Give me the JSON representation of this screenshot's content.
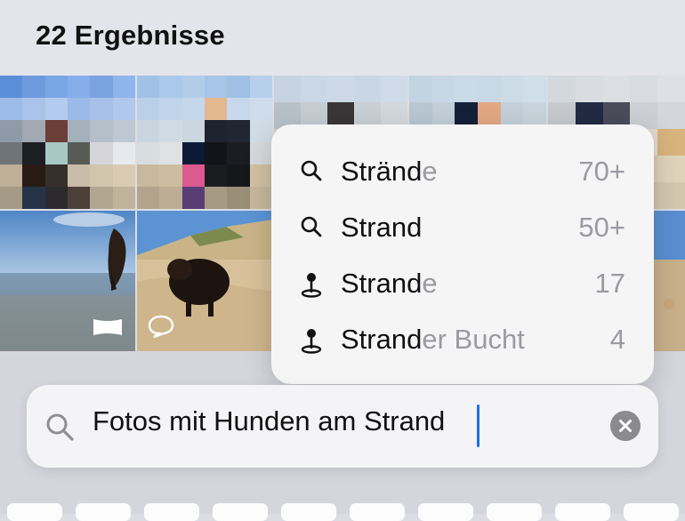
{
  "header": {
    "title": "22 Ergebnisse"
  },
  "photos": [
    {
      "id": "photo-1"
    },
    {
      "id": "photo-2"
    },
    {
      "id": "photo-3"
    },
    {
      "id": "photo-4"
    },
    {
      "id": "photo-5"
    },
    {
      "id": "photo-6"
    },
    {
      "id": "photo-7"
    },
    {
      "id": "photo-8"
    },
    {
      "id": "photo-9"
    },
    {
      "id": "photo-10"
    }
  ],
  "suggestions": [
    {
      "icon": "search-icon",
      "match": "Stränd",
      "rest": "e",
      "count": "70+"
    },
    {
      "icon": "search-icon",
      "match": "Strand",
      "rest": "",
      "count": "50+"
    },
    {
      "icon": "location-pin-icon",
      "match": "Strand",
      "rest": "e",
      "count": "17"
    },
    {
      "icon": "location-pin-icon",
      "match": "Strand",
      "rest": "er Bucht",
      "count": "4"
    }
  ],
  "search": {
    "query": "Fotos mit Hunden am Strand"
  },
  "colors": {
    "accent": "#1f6fe8",
    "secondary_text": "#9a9aa0"
  }
}
